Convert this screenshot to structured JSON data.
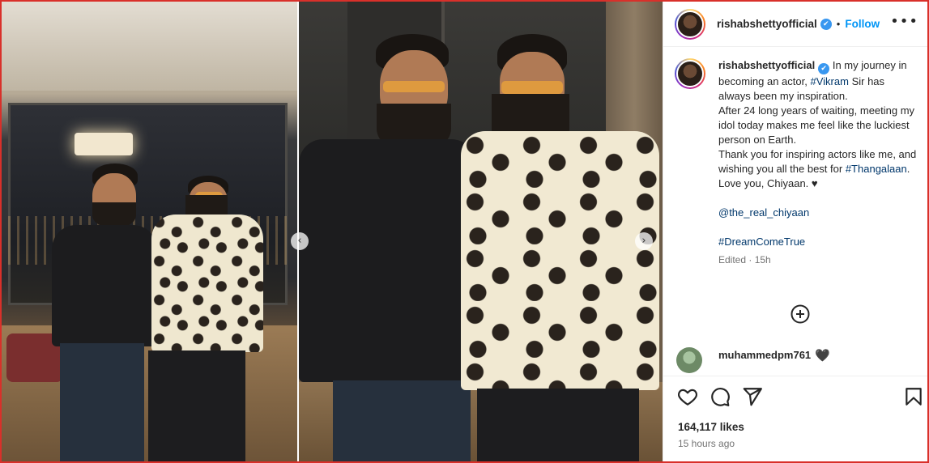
{
  "post": {
    "username": "rishabshettyofficial",
    "verified_mark": "✔",
    "dot": "•",
    "follow_label": "Follow",
    "more_label": "•••"
  },
  "caption": {
    "username": "rishabshettyofficial",
    "line1_a": "In my journey in becoming an actor,",
    "tag_vikram": "#Vikram",
    "line1_b": "Sir has always been my inspiration.",
    "line2": "After 24 long years of waiting, meeting my idol today makes me feel like the luckiest person on Earth.",
    "line3": "Thank you for inspiring actors like me, and wishing you all the best for",
    "tag_thangalaan": "#Thangalaan",
    "line3_end": ".",
    "line4": "Love you, Chiyaan. ♥",
    "mention": "@the_real_chiyaan",
    "tag_dream": "#DreamComeTrue",
    "edited": "Edited · 15h"
  },
  "comment": {
    "username": "muhammedpm761",
    "heart": "🖤"
  },
  "actions": {
    "likes": "164,117 likes",
    "time": "15 hours ago"
  },
  "carousel": {
    "prev_label": "‹",
    "next_label": "›"
  },
  "icons": [
    "more-icon",
    "add-comment-icon",
    "like-icon",
    "comment-icon",
    "share-icon",
    "save-icon",
    "verified-icon"
  ],
  "colors": {
    "accent": "#0095f6",
    "link": "#00376b",
    "frame": "#d9302a",
    "verified": "#3897f0",
    "muted": "#737373"
  }
}
